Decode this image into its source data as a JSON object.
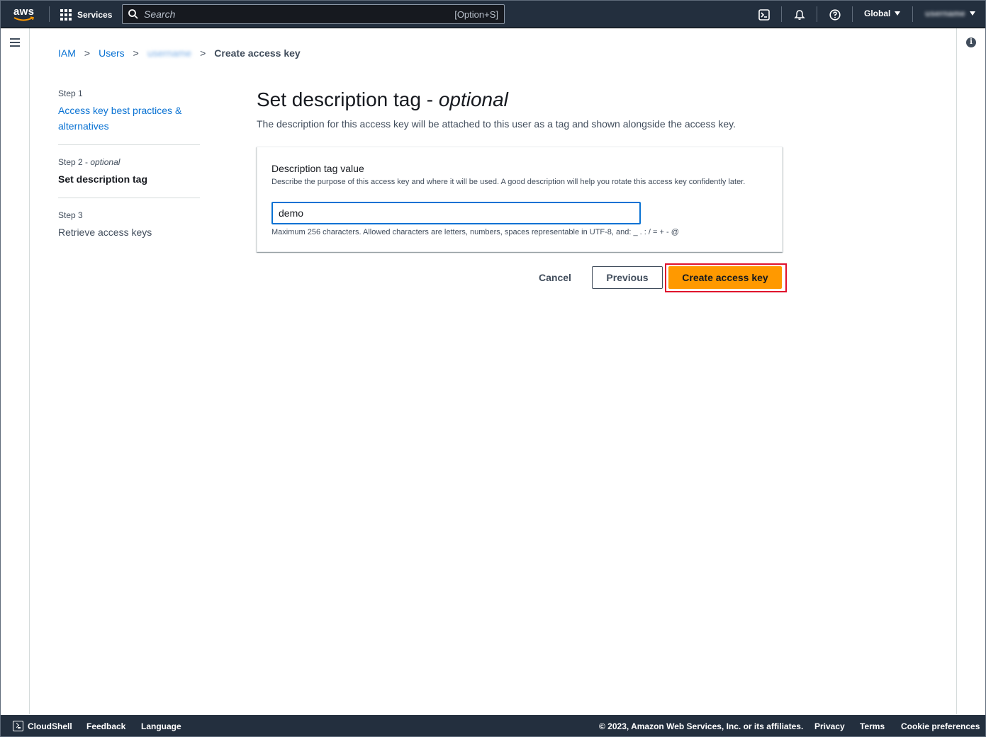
{
  "topnav": {
    "logo_text": "aws",
    "services_label": "Services",
    "search_placeholder": "Search",
    "search_shortcut": "[Option+S]",
    "region_label": "Global",
    "account_label": "username"
  },
  "breadcrumb": {
    "items": [
      "IAM",
      "Users",
      "username"
    ],
    "current": "Create access key"
  },
  "steps": [
    {
      "number": "Step 1",
      "optional": "",
      "title": "Access key best practices & alternatives",
      "state": "link"
    },
    {
      "number": "Step 2",
      "optional": "optional",
      "title": "Set description tag",
      "state": "active"
    },
    {
      "number": "Step 3",
      "optional": "",
      "title": "Retrieve access keys",
      "state": "disabled"
    }
  ],
  "main": {
    "title": "Set description tag - ",
    "title_emphasis": "optional",
    "description": "The description for this access key will be attached to this user as a tag and shown alongside the access key."
  },
  "form": {
    "label": "Description tag value",
    "help": "Describe the purpose of this access key and where it will be used. A good description will help you rotate this access key confidently later.",
    "value": "demo",
    "constraint": "Maximum 256 characters. Allowed characters are letters, numbers, spaces representable in UTF-8, and: _ . : / = + - @"
  },
  "actions": {
    "cancel": "Cancel",
    "previous": "Previous",
    "create": "Create access key"
  },
  "footer": {
    "cloudshell": "CloudShell",
    "feedback": "Feedback",
    "language": "Language",
    "copyright": "© 2023, Amazon Web Services, Inc. or its affiliates.",
    "privacy": "Privacy",
    "terms": "Terms",
    "cookies": "Cookie preferences"
  },
  "colors": {
    "nav_bg": "#232f3e",
    "link": "#0972d3",
    "primary_button": "#ff9900",
    "highlight": "#e0102c"
  }
}
